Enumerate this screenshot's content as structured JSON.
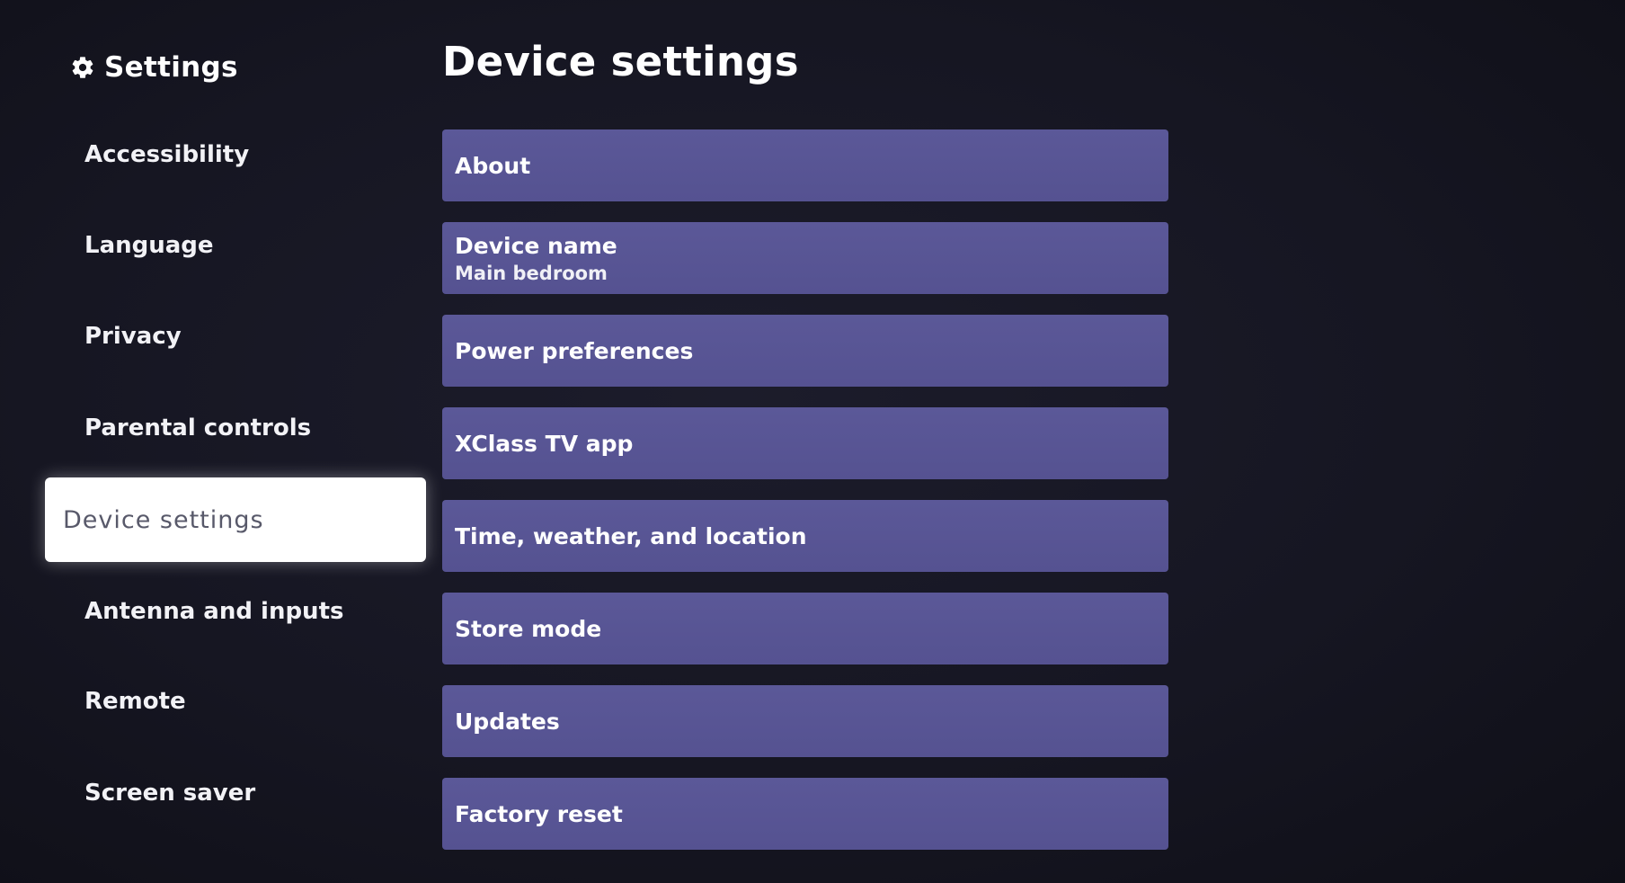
{
  "header": {
    "icon": "gear-icon",
    "title": "Settings"
  },
  "sidebar": {
    "items": [
      {
        "label": "Accessibility"
      },
      {
        "label": "Language"
      },
      {
        "label": "Privacy"
      },
      {
        "label": "Parental controls"
      },
      {
        "label": "Device settings",
        "selected": true
      },
      {
        "label": "Antenna and inputs"
      },
      {
        "label": "Remote"
      },
      {
        "label": "Screen saver"
      }
    ]
  },
  "main": {
    "title": "Device settings",
    "rows": [
      {
        "label": "About"
      },
      {
        "label": "Device name",
        "value": "Main bedroom"
      },
      {
        "label": "Power preferences"
      },
      {
        "label": "XClass TV app"
      },
      {
        "label": "Time, weather, and location"
      },
      {
        "label": "Store mode"
      },
      {
        "label": "Updates"
      },
      {
        "label": "Factory reset"
      }
    ]
  },
  "colors": {
    "background": "#161622",
    "row_fill": "#5a5796",
    "selected_fill": "#ffffff",
    "selected_text": "#58596a"
  }
}
